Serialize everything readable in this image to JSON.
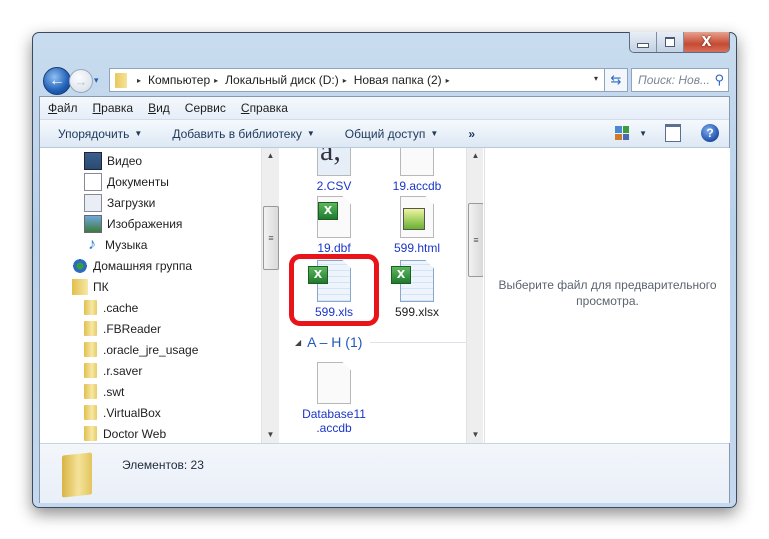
{
  "window": {
    "controls": {
      "minimize": "minimize",
      "maximize": "maximize",
      "close": "X"
    }
  },
  "nav_buttons": {
    "back_icon": "←",
    "forward_icon": "→",
    "history_icon": "▾"
  },
  "address_bar": {
    "breadcrumbs": [
      "Компьютер",
      "Локальный диск (D:)",
      "Новая папка (2)"
    ],
    "separator": "▸",
    "dropdown_icon": "▾"
  },
  "refresh_icon": "⇆",
  "search": {
    "placeholder": "Поиск: Нов...",
    "icon": "⚲"
  },
  "menubar": {
    "items": [
      {
        "accel": "Ф",
        "rest": "айл"
      },
      {
        "accel": "П",
        "rest": "равка"
      },
      {
        "accel": "В",
        "rest": "ид"
      },
      {
        "accel": "С",
        "rest": "ервис",
        "pre": "С",
        "label": "Сервис"
      },
      {
        "accel": "С",
        "rest": "правка"
      }
    ]
  },
  "toolbar": {
    "organize": "Упорядочить",
    "add_to_library": "Добавить в библиотеку",
    "share": "Общий доступ",
    "more": "»",
    "dropdown": "▼",
    "help": "?"
  },
  "nav_pane": {
    "items": [
      {
        "label": "Видео",
        "icon": "video"
      },
      {
        "label": "Документы",
        "icon": "documents"
      },
      {
        "label": "Загрузки",
        "icon": "downloads"
      },
      {
        "label": "Изображения",
        "icon": "images"
      },
      {
        "label": "Музыка",
        "icon": "music"
      },
      {
        "label": "Домашняя группа",
        "icon": "homegroup"
      },
      {
        "label": "ПК",
        "icon": "user-folder"
      },
      {
        "label": ".cache",
        "icon": "folder"
      },
      {
        "label": ".FBReader",
        "icon": "folder"
      },
      {
        "label": ".oracle_jre_usage",
        "icon": "folder"
      },
      {
        "label": ".r.saver",
        "icon": "folder"
      },
      {
        "label": ".swt",
        "icon": "folder"
      },
      {
        "label": ".VirtualBox",
        "icon": "folder"
      },
      {
        "label": "Doctor Web",
        "icon": "folder"
      }
    ],
    "music_glyph": "♪"
  },
  "scroll": {
    "up": "▲",
    "down": "▼",
    "grip": "≡"
  },
  "files": [
    {
      "name": "2.CSV",
      "type": "csv",
      "glyph": "a,"
    },
    {
      "name": "19.accdb",
      "type": "blank"
    },
    {
      "name": "19.dbf",
      "type": "excel",
      "glyph": "X"
    },
    {
      "name": "599.html",
      "type": "html"
    },
    {
      "name": "599.xls",
      "type": "excel-grid",
      "glyph": "X",
      "highlighted": true
    },
    {
      "name": "599.xlsx",
      "type": "excel-grid",
      "glyph": "X"
    },
    {
      "name": "Database11 .accdb",
      "line1": "Database11",
      "line2": ".accdb",
      "type": "blank"
    }
  ],
  "group_header": {
    "label": "A – H (1)",
    "toggle": "◢"
  },
  "preview_pane": {
    "message_line1": "Выберите файл для предварительного",
    "message_line2": "просмотра."
  },
  "status_bar": {
    "text": "Элементов: 23"
  },
  "colors": {
    "highlight": "#e8141a",
    "link": "#1a35c8"
  }
}
